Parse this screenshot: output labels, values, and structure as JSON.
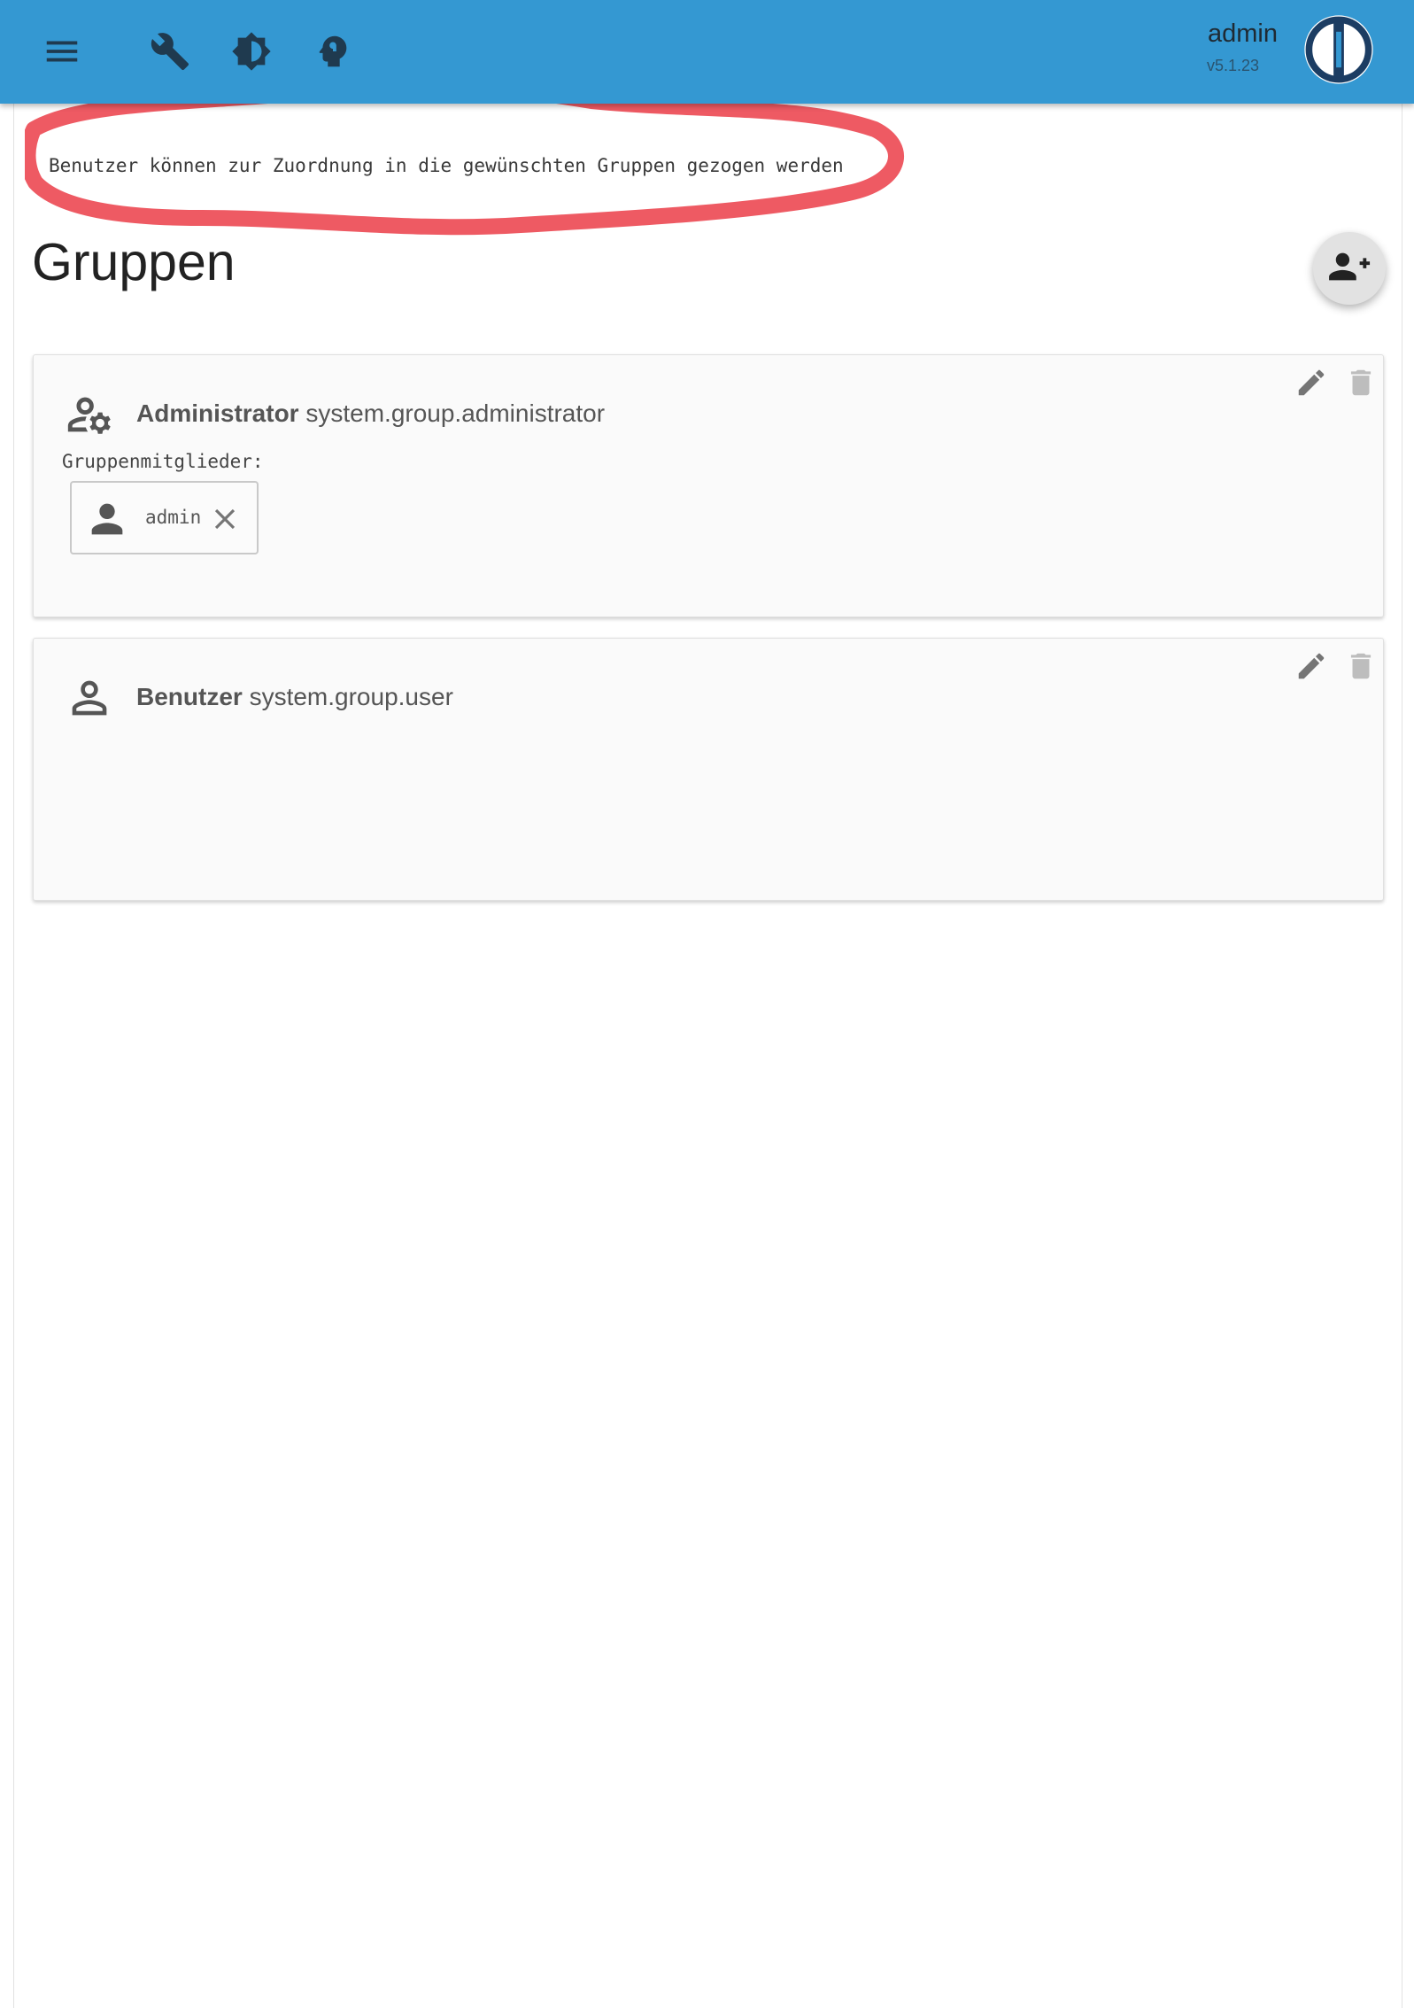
{
  "header": {
    "user_name": "admin",
    "version": "v5.1.23",
    "accent_color": "#3498d2",
    "icons": [
      "menu-icon",
      "wrench-icon",
      "brightness-icon",
      "expert-mode-icon"
    ]
  },
  "hint": {
    "text": "Benutzer können zur Zuordnung in die gewünschten Gruppen gezogen werden",
    "annotation_color": "#ee5a63"
  },
  "page": {
    "title": "Gruppen",
    "add_group_icon": "add-group-icon"
  },
  "groups": [
    {
      "name": "Administrator",
      "id": "system.group.administrator",
      "icon": "user-gear-icon",
      "members_label": "Gruppenmitglieder:",
      "members": [
        {
          "name": "admin",
          "icon": "person-icon"
        }
      ]
    },
    {
      "name": "Benutzer",
      "id": "system.group.user",
      "icon": "person-outline-icon",
      "members": []
    }
  ]
}
